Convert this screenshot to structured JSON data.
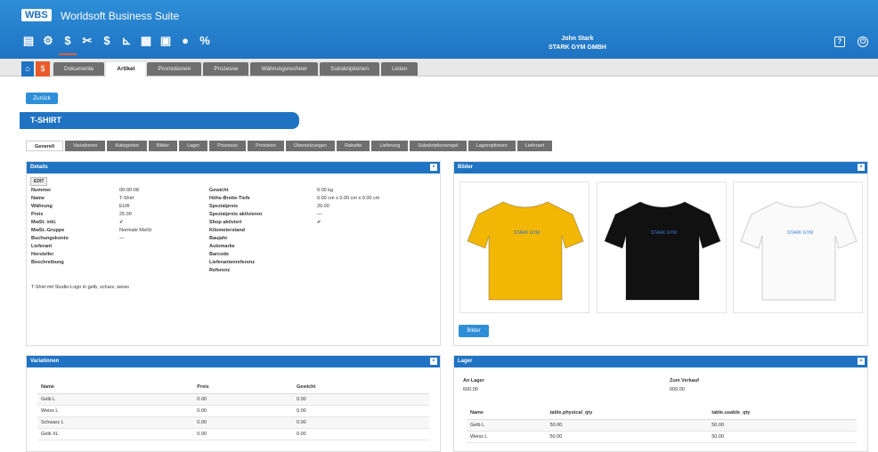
{
  "app": {
    "logo": "WBS",
    "title": "Worldsoft Business Suite"
  },
  "toolbar": {
    "icons": [
      "contact-card-icon",
      "user-settings-icon",
      "sales-icon",
      "tools-icon",
      "finance-icon",
      "chart-icon",
      "calendar-icon",
      "messages-icon",
      "users-icon",
      "percent-icon"
    ],
    "glyphs": [
      "▤",
      "⚙",
      "$",
      "✂",
      "$",
      "⊾",
      "▦",
      "▣",
      "●",
      "%"
    ]
  },
  "user": {
    "name": "John Stark",
    "company": "STARK GYM GMBH"
  },
  "header_buttons": {
    "help": "?",
    "power": "⏻"
  },
  "nav": {
    "home_icon": "⌂",
    "sales_icon": "$",
    "tabs": [
      "Dokumente",
      "Artikel",
      "Promotionen",
      "Prozesse",
      "Währungsrechner",
      "Subskriptionen",
      "Listen"
    ],
    "active": "Artikel"
  },
  "back_label": "Zurück",
  "article_title": "T-SHIRT",
  "sub_tabs": [
    "Generell",
    "Variationen",
    "Kategorien",
    "Bilder",
    "Lager",
    "Prozesse",
    "Provision",
    "Übersetzungen",
    "Rabatte",
    "Lieferung",
    "Subskriptionsregel",
    "Lageroptionen",
    "Lieferant"
  ],
  "details": {
    "header": "Details",
    "edit_label": "EDIT",
    "minimize": "▪",
    "left": [
      {
        "label": "Nummer",
        "value": "00-00-08"
      },
      {
        "label": "Name",
        "value": "T-Shirt"
      },
      {
        "label": "Währung",
        "value": "EUR"
      },
      {
        "label": "Preis",
        "value": "25.00"
      },
      {
        "label": "MwSt. inkl.",
        "value": "✔"
      },
      {
        "label": "MwSt.-Gruppe",
        "value": "Normale MwSt"
      },
      {
        "label": "Buchungskonto",
        "value": "—"
      },
      {
        "label": "Lieferant",
        "value": ""
      },
      {
        "label": "Hersteller",
        "value": ""
      },
      {
        "label": "Beschreibung",
        "value": ""
      }
    ],
    "description": "T-Shirt mit Studio-Logo in gelb, scharz, weiss",
    "right": [
      {
        "label": "Gewicht",
        "value": "0.00 kg"
      },
      {
        "label": "Höhe-Breite-Tiefe",
        "value": "0.00 cm x 0.00 cm x 0.00 cm"
      },
      {
        "label": "Spezialpreis",
        "value": "20.00"
      },
      {
        "label": "Spezialpreis aktivieren",
        "value": "—"
      },
      {
        "label": "Shop aktiviert",
        "value": "✔"
      },
      {
        "label": "Kilometerstand",
        "value": ""
      },
      {
        "label": "Baujahr",
        "value": ""
      },
      {
        "label": "Automarke",
        "value": ""
      },
      {
        "label": "Barcode",
        "value": ""
      },
      {
        "label": "Lieferantenreferenz",
        "value": ""
      },
      {
        "label": "Referenz",
        "value": ""
      }
    ]
  },
  "bilder": {
    "header": "Bilder",
    "minimize": "▪",
    "button": "Bilder",
    "images": [
      {
        "color": "#f2b705",
        "logo": "STARK GYM",
        "logo_color": "#2e6fd0"
      },
      {
        "color": "#111111",
        "logo": "STARK GYM",
        "logo_color": "#3b7fd8"
      },
      {
        "color": "#fafafa",
        "logo": "STARK GYM",
        "logo_color": "#3b7fd8"
      }
    ]
  },
  "variationen": {
    "header": "Variationen",
    "minimize": "▪",
    "columns": [
      "Name",
      "Preis",
      "Gewicht"
    ],
    "rows": [
      [
        "Gelb L",
        "0.00",
        "0.00"
      ],
      [
        "Weiss L",
        "0.00",
        "0.00"
      ],
      [
        "Schwarz L",
        "0.00",
        "0.00"
      ],
      [
        "Gelb XL",
        "0.00",
        "0.00"
      ]
    ]
  },
  "lager": {
    "header": "Lager",
    "minimize": "▪",
    "an_lager_label": "An Lager",
    "an_lager_value": "600.00",
    "zum_verkauf_label": "Zum Verkauf",
    "zum_verkauf_value": "600.00",
    "columns": [
      "Name",
      "table.physical_qty",
      "table.usable_qty"
    ],
    "rows": [
      [
        "Gelb L",
        "50.00",
        "50.00"
      ],
      [
        "Weiss L",
        "50.00",
        "50.00"
      ]
    ]
  },
  "colors": {
    "header_blue": "#1f73c2",
    "accent_orange": "#e85c2b",
    "tab_gray": "#6f6f6f"
  }
}
